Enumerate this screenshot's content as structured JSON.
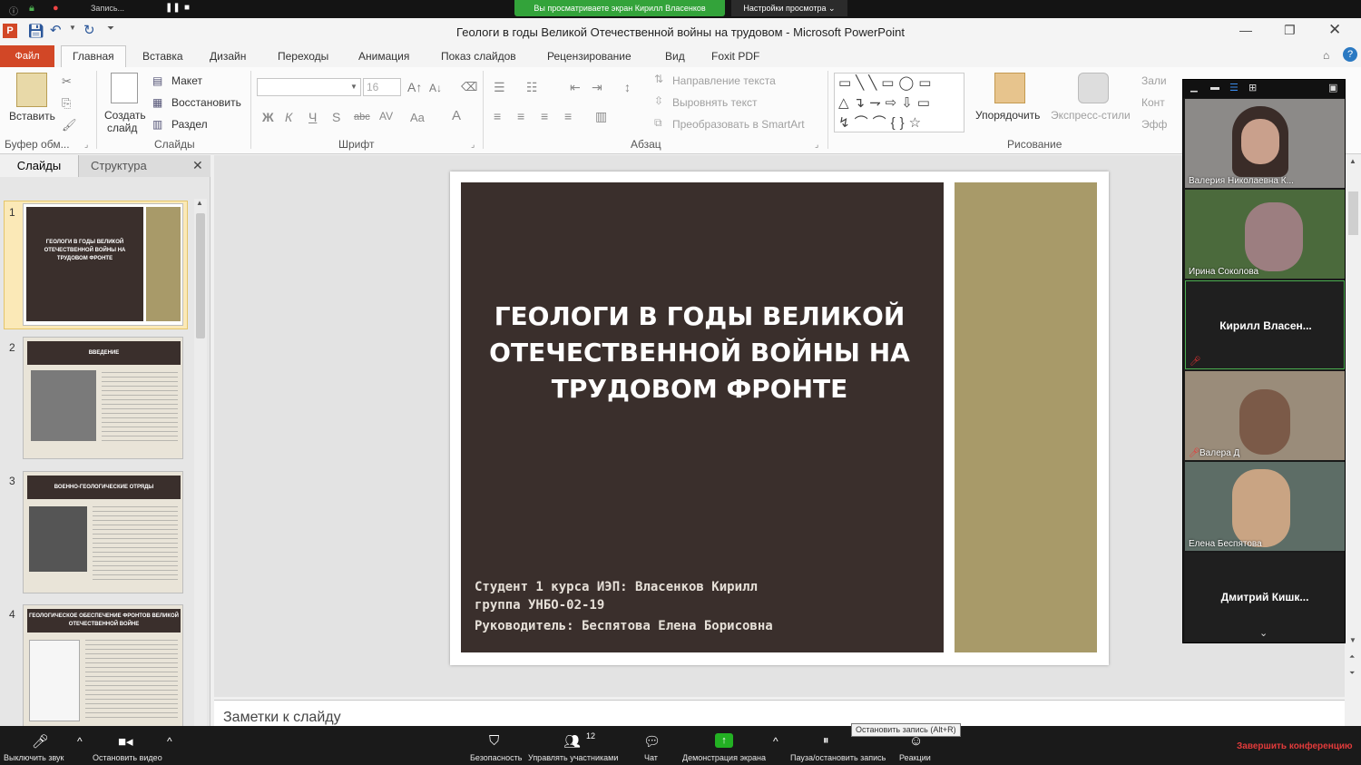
{
  "zoom_top": {
    "recording_label": "Запись...",
    "sharing_banner": "Вы просматриваете экран Кирилл Власенков",
    "view_options": "Настройки просмотра"
  },
  "window": {
    "title": "Геологи в годы Великой Отечественной войны на трудовом  -  Microsoft PowerPoint"
  },
  "tabs": [
    "Файл",
    "Главная",
    "Вставка",
    "Дизайн",
    "Переходы",
    "Анимация",
    "Показ слайдов",
    "Рецензирование",
    "Вид",
    "Foxit PDF"
  ],
  "ribbon": {
    "clipboard": {
      "paste": "Вставить",
      "label": "Буфер обм..."
    },
    "slides": {
      "create_1": "Создать",
      "create_2": "слайд",
      "layout": "Макет",
      "restore": "Восстановить",
      "section": "Раздел",
      "label": "Слайды"
    },
    "font": {
      "size": "16",
      "label": "Шрифт"
    },
    "paragraph": {
      "text_direction": "Направление текста",
      "align_text": "Выровнять текст",
      "smartart": "Преобразовать в SmartArt",
      "label": "Абзац"
    },
    "drawing": {
      "arrange": "Упорядочить",
      "quick_styles": "Экспресс-стили",
      "fill": "Зали",
      "outline": "Конт",
      "effects": "Эфф",
      "label": "Рисование"
    }
  },
  "left_panel": {
    "tab_slides": "Слайды",
    "tab_outline": "Структура",
    "thumbs": [
      {
        "num": "1",
        "title": "ГЕОЛОГИ В ГОДЫ ВЕЛИКОЙ ОТЕЧЕСТВЕННОЙ ВОЙНЫ НА ТРУДОВОМ ФРОНТЕ"
      },
      {
        "num": "2",
        "title": "ВВЕДЕНИЕ"
      },
      {
        "num": "3",
        "title": "ВОЕННО-ГЕОЛОГИЧЕСКИЕ ОТРЯДЫ"
      },
      {
        "num": "4",
        "title": "ГЕОЛОГИЧЕСКОЕ ОБЕСПЕЧЕНИЕ ФРОНТОВ ВЕЛИКОЙ ОТЕЧЕСТВЕННОЙ ВОЙНЕ"
      }
    ]
  },
  "slide": {
    "title_line1": "ГЕОЛОГИ В ГОДЫ ВЕЛИКОЙ",
    "title_line2": "ОТЕЧЕСТВЕННОЙ ВОЙНЫ НА",
    "title_line3": "ТРУДОВОМ ФРОНТЕ",
    "student": "Студент 1 курса ИЭП: Власенков Кирилл",
    "group": "группа УНБО-02-19",
    "supervisor": "Руководитель: Беспятова Елена Борисовна",
    "colors": {
      "dark": "#3a2f2c",
      "olive": "#a89a69"
    }
  },
  "notes_placeholder": "Заметки к слайду",
  "participants": [
    {
      "name": "Валерия Николаевна К..."
    },
    {
      "name": "Ирина Соколова"
    },
    {
      "name": "Кирилл  Власен..."
    },
    {
      "name": "Валера Д"
    },
    {
      "name": "Елена Беспятова"
    },
    {
      "name": "Дмитрий  Кишк..."
    }
  ],
  "zoom_bottom": {
    "mute": "Выключить звук",
    "stop_video": "Остановить видео",
    "security": "Безопасность",
    "participants": "Управлять участниками",
    "participants_count": "12",
    "chat": "Чат",
    "share": "Демонстрация экрана",
    "pause_record": "Пауза/остановить запись",
    "reactions": "Реакции",
    "end": "Завершить конференцию",
    "tooltip": "Остановить запись (Alt+R)"
  }
}
